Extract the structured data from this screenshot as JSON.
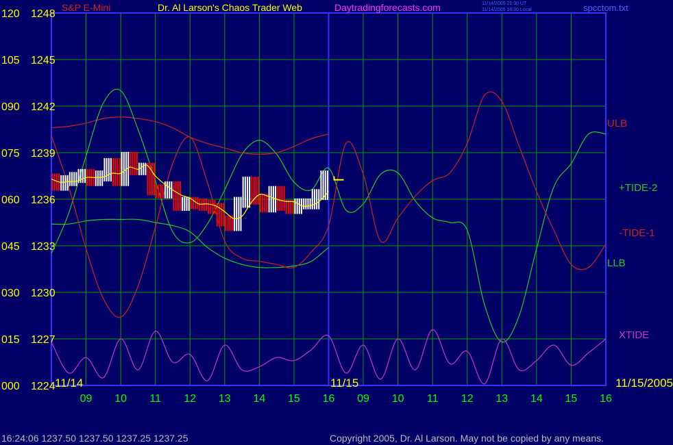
{
  "header": {
    "symbol": "S&P E-Mini",
    "site_title": "Dr. Al Larson's Chaos Trader Web",
    "site_url": "Daytradingforecasts.com",
    "ut_stamp": "11/14/2005 21:30 UT",
    "local_stamp": "11/14/2005 16:30 Local",
    "filename": "spcctom.txt"
  },
  "footer": {
    "last_bar": "16:24:06  1237.50  1237.50  1237.25  1237.25",
    "copyright": "Copyright 2005, Dr. Al Larson. May not be copied by any means."
  },
  "colors": {
    "background": "#000066",
    "grid": "#00a000",
    "frame": "#3333ff",
    "axis_text": "#ffff00",
    "time_text": "#00ff00",
    "ulb": "#cc2222",
    "tide2": "#22cc22",
    "tide1": "#cc2222",
    "llb": "#22cc22",
    "xtide": "#cc33cc",
    "price_up": "#ffffff",
    "price_down": "#ff0000",
    "average": "#ffff00"
  },
  "chart_data": {
    "type": "line",
    "title": "Dr. Al Larson's Chaos Trader Web",
    "subtitle": "S&P E-Mini",
    "ylim": [
      1224,
      1248
    ],
    "grid": true,
    "y_ticks_left": [
      "000",
      "015",
      "030",
      "045",
      "060",
      "075",
      "090",
      "105",
      "120"
    ],
    "y_ticks_right": [
      "1224",
      "1227",
      "1230",
      "1233",
      "1236",
      "1239",
      "1242",
      "1245",
      "1248"
    ],
    "x_ticks": [
      "09",
      "10",
      "11",
      "12",
      "13",
      "14",
      "15",
      "16",
      "09",
      "10",
      "11",
      "12",
      "13",
      "14",
      "15",
      "16"
    ],
    "date_labels": [
      "11/14",
      "11/15",
      "11/15/2005"
    ],
    "series_labels": [
      "ULB",
      "+TIDE-2",
      "-TIDE-1",
      "LLB",
      "XTIDE"
    ],
    "x": [
      8.0,
      8.5,
      9.0,
      9.5,
      10.0,
      10.5,
      11.0,
      11.5,
      12.0,
      12.5,
      13.0,
      13.5,
      14.0,
      14.5,
      15.0,
      15.5,
      16.0,
      16.5,
      17.0,
      17.5,
      18.0,
      18.5,
      19.0,
      19.5,
      20.0,
      20.5,
      21.0,
      21.5,
      22.0,
      22.5,
      23.0,
      23.5,
      24.0
    ],
    "series": [
      {
        "name": "ULB",
        "values": [
          1240.6,
          1240.7,
          1240.9,
          1241.2,
          1241.3,
          1241.2,
          1241.0,
          1240.6,
          1240.0,
          1239.6,
          1239.3,
          1239.0,
          1238.9,
          1239.0,
          1239.4,
          1239.9,
          1240.2
        ]
      },
      {
        "name": "LLB",
        "values": [
          1234.4,
          1234.4,
          1234.6,
          1234.7,
          1234.7,
          1234.7,
          1234.5,
          1234.3,
          1233.9,
          1232.9,
          1232.2,
          1231.8,
          1231.6,
          1231.6,
          1231.7,
          1232.0,
          1232.9
        ]
      },
      {
        "name": "+TIDE-2",
        "values": [
          1232.5,
          1235.1,
          1238.8,
          1242.2,
          1243.0,
          1240.5,
          1237.2,
          1233.9,
          1233.2,
          1234.4,
          1236.6,
          1238.9,
          1239.8,
          1238.9,
          1237.1,
          1236.6,
          1238.0,
          1235.3,
          1235.7,
          1237.6,
          1237.7,
          1235.9,
          1234.8,
          1234.5,
          1234.0,
          1229.2,
          1226.8,
          1228.5,
          1232.8,
          1236.8,
          1238.3,
          1240.2,
          1240.2
        ]
      },
      {
        "name": "-TIDE-1",
        "values": [
          1240.1,
          1236.8,
          1232.8,
          1229.6,
          1228.4,
          1230.4,
          1234.2,
          1238.3,
          1240.0,
          1237.1,
          1233.3,
          1232.2,
          1232.0,
          1231.8,
          1231.6,
          1232.6,
          1234.3,
          1239.6,
          1237.6,
          1233.3,
          1234.8,
          1236.2,
          1237.2,
          1237.7,
          1239.6,
          1242.7,
          1242.3,
          1239.4,
          1236.5,
          1234.0,
          1231.8,
          1231.6,
          1233.1
        ]
      },
      {
        "name": "XTIDE",
        "values": [
          1226.8,
          1224.8,
          1225.8,
          1224.5,
          1227.0,
          1225.0,
          1227.5,
          1225.5,
          1226.0,
          1224.3,
          1226.6,
          1225.0,
          1225.2,
          1225.8,
          1225.6,
          1226.3,
          1227.2,
          1224.8,
          1226.6,
          1224.4,
          1227.0,
          1225.0,
          1227.6,
          1225.4,
          1226.2,
          1224.1,
          1227.0,
          1225.0,
          1225.6,
          1226.6,
          1225.3,
          1226.1,
          1227.0
        ]
      }
    ],
    "price": {
      "x": [
        8.0,
        8.25,
        8.5,
        8.75,
        9.0,
        9.25,
        9.5,
        9.75,
        10.0,
        10.25,
        10.5,
        10.75,
        11.0,
        11.25,
        11.5,
        11.75,
        12.0,
        12.25,
        12.5,
        12.75,
        13.0,
        13.25,
        13.5,
        13.75,
        14.0,
        14.25,
        14.5,
        14.75,
        15.0,
        15.25,
        15.5,
        15.75,
        16.0
      ],
      "values": [
        1237.3,
        1236.9,
        1237.2,
        1237.4,
        1237.6,
        1237.2,
        1237.5,
        1238.3,
        1237.2,
        1238.7,
        1237.9,
        1238.0,
        1236.6,
        1236.4,
        1236.8,
        1235.6,
        1235.8,
        1235.7,
        1235.6,
        1235.4,
        1234.6,
        1234.3,
        1235.8,
        1237.1,
        1236.0,
        1235.5,
        1236.5,
        1235.6,
        1235.4,
        1235.7,
        1235.7,
        1236.3,
        1237.5
      ]
    },
    "last_price": 1237.25
  }
}
